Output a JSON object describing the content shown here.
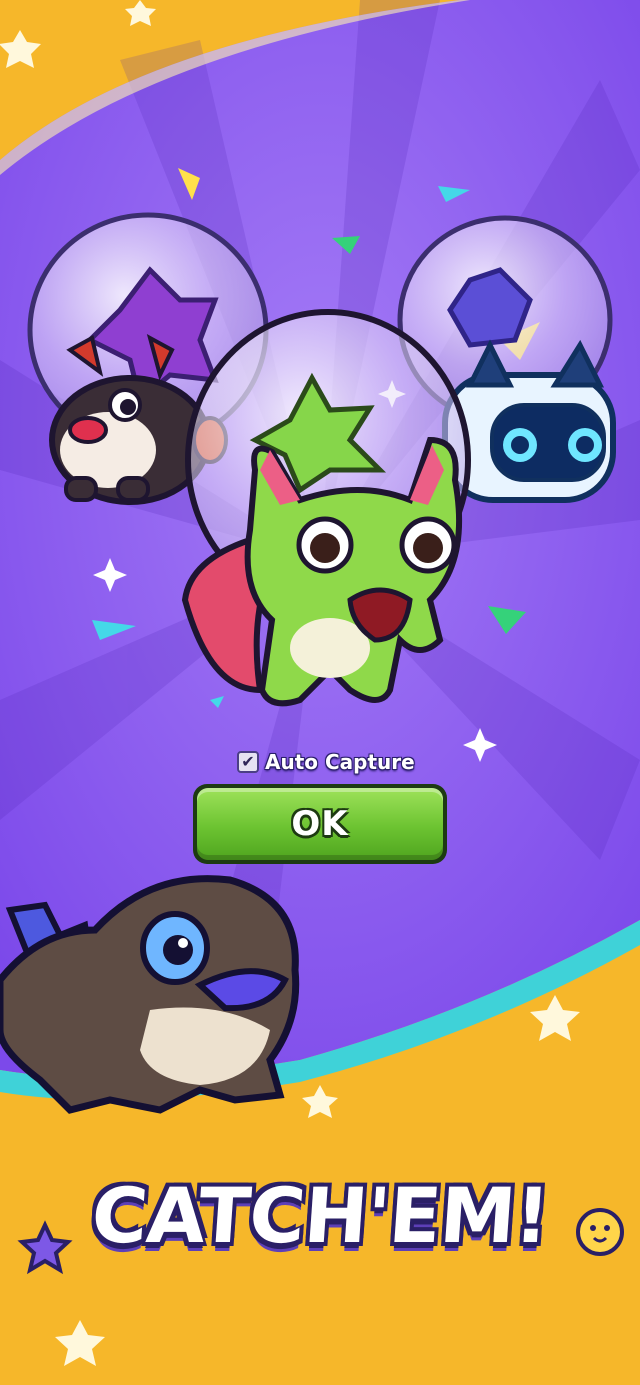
{
  "auto_capture": {
    "label": "Auto Capture",
    "checked": true,
    "check_glyph": "✔"
  },
  "ok_button": {
    "label": "OK"
  },
  "banner": {
    "title": "CATCH'EM!"
  },
  "colors": {
    "background_purple": "#8b5cf0",
    "ray_purple": "#7a49e3",
    "frame_yellow": "#f6b72a",
    "button_green": "#6cc331",
    "outline_dark": "#2a1f66"
  },
  "characters": [
    {
      "name": "red-eared-dog-creature-icon"
    },
    {
      "name": "green-leaf-cat-creature-icon"
    },
    {
      "name": "blue-robot-cat-creature-icon"
    },
    {
      "name": "brown-lizard-creature-icon"
    }
  ]
}
